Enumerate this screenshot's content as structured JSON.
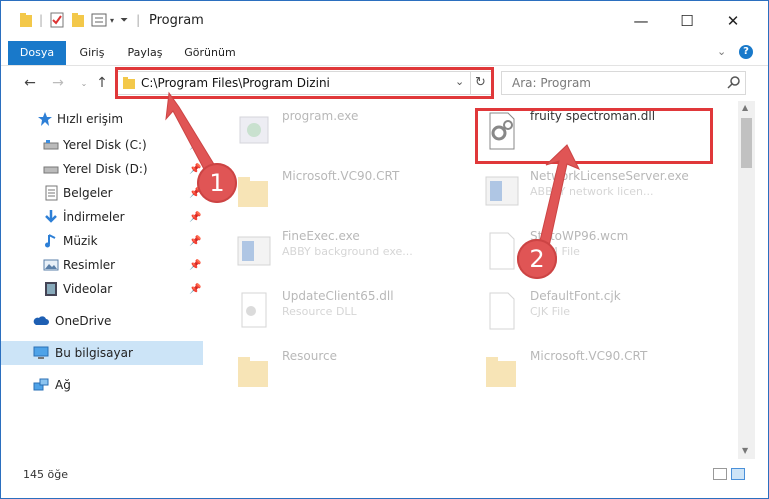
{
  "window": {
    "title": "Program",
    "minimize_glyph": "—",
    "maximize_glyph": "☐",
    "close_glyph": "✕"
  },
  "ribbon": {
    "tabs": [
      "Dosya",
      "Giriş",
      "Paylaş",
      "Görünüm"
    ],
    "accent": "#1979ca"
  },
  "nav": {
    "back_glyph": "←",
    "forward_glyph": "→",
    "up_glyph": "↑",
    "address": "C:\\Program Files\\Program Dizini",
    "search_placeholder": "Ara: Program"
  },
  "navpane": {
    "items": [
      {
        "label": "Hızlı erişim",
        "icon": "star-icon"
      },
      {
        "label": "Yerel Disk (C:)",
        "icon": "drive-icon"
      },
      {
        "label": "Yerel Disk (D:)",
        "icon": "drive-icon"
      },
      {
        "label": "Belgeler",
        "icon": "documents-icon"
      },
      {
        "label": "İndirmeler",
        "icon": "download-icon"
      },
      {
        "label": "Müzik",
        "icon": "music-icon"
      },
      {
        "label": "Resimler",
        "icon": "pictures-icon"
      },
      {
        "label": "Videolar",
        "icon": "video-icon"
      },
      {
        "label": "OneDrive",
        "icon": "cloud-icon"
      },
      {
        "label": "Bu bilgisayar",
        "icon": "computer-icon"
      },
      {
        "label": "Ağ",
        "icon": "network-icon"
      }
    ]
  },
  "files": {
    "left": [
      {
        "name": "program.exe",
        "sub": ""
      },
      {
        "name": "Microsoft.VC90.CRT",
        "sub": ""
      },
      {
        "name": "FineExec.exe",
        "sub": "ABBY background exe..."
      },
      {
        "name": "UpdateClient65.dll",
        "sub": "Resource DLL"
      },
      {
        "name": "Resource",
        "sub": ""
      }
    ],
    "right": [
      {
        "name": "fruity spectroman.dll",
        "sub": ""
      },
      {
        "name": "NetworkLicenseServer.exe",
        "sub": "ABBYY network licen..."
      },
      {
        "name": "StdtoWP96.wcm",
        "sub": "WCM File"
      },
      {
        "name": "DefaultFont.cjk",
        "sub": "CJK File"
      },
      {
        "name": "Microsoft.VC90.CRT",
        "sub": ""
      }
    ]
  },
  "annotations": {
    "badge1": "1",
    "badge2": "2",
    "color": "#e0383a"
  },
  "status": {
    "count": "145 öğe"
  }
}
